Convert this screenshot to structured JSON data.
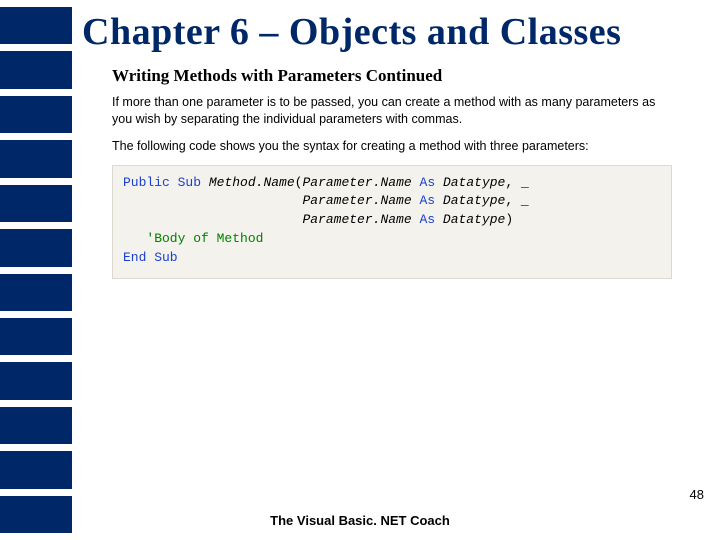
{
  "title": "Chapter 6 – Objects and Classes",
  "subheading": "Writing Methods with Parameters Continued",
  "para1": "If more than one parameter is to be passed, you can create a method with as many parameters as you wish by separating the individual parameters with commas.",
  "para2": "The following code shows you the syntax for creating a method with three parameters:",
  "code": {
    "kw_public": "Public",
    "kw_sub": "Sub",
    "method_name": "Method.Name",
    "open": "(",
    "param": "Parameter.Name",
    "kw_as": "As",
    "datatype": "Datatype",
    "comma_cont": ", _",
    "close": ")",
    "comment": "'Body of Method",
    "kw_end_sub": "End Sub"
  },
  "page_number": "48",
  "footer": "The Visual Basic. NET Coach"
}
